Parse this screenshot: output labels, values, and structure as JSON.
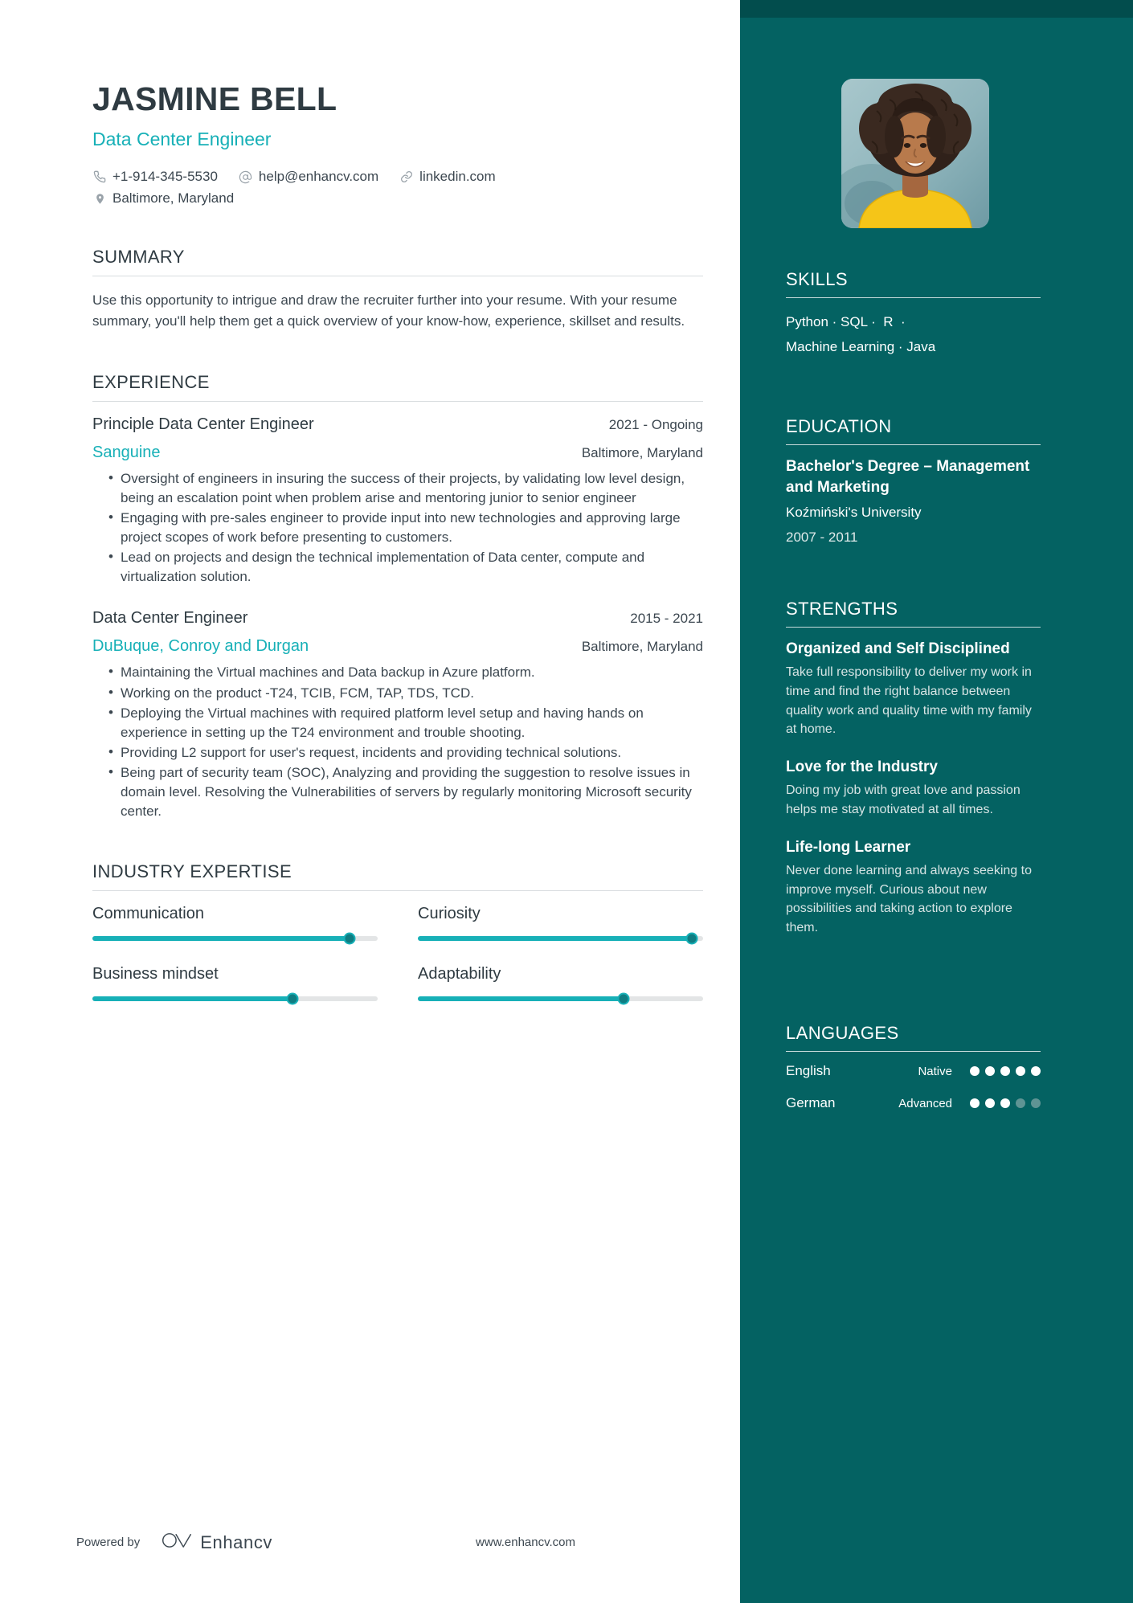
{
  "theme": {
    "sidebar_bg": "#046262",
    "sidebar_top_strip": "#024d4d",
    "accent": "#17b0b7",
    "text_dark": "#2f3b42",
    "text_body": "#3c4750"
  },
  "header": {
    "name": "JASMINE BELL",
    "role": "Data Center Engineer",
    "contacts": [
      {
        "icon": "phone-icon",
        "value": "+1-914-345-5530"
      },
      {
        "icon": "email-icon",
        "value": "help@enhancv.com"
      },
      {
        "icon": "link-icon",
        "value": "linkedin.com"
      }
    ],
    "location": {
      "icon": "location-pin-icon",
      "value": "Baltimore, Maryland"
    }
  },
  "summary": {
    "heading": "SUMMARY",
    "text": "Use this opportunity to intrigue and draw the recruiter further into your resume. With your resume summary, you'll help them get a quick overview of your know-how, experience, skillset and results."
  },
  "experience": {
    "heading": "EXPERIENCE",
    "jobs": [
      {
        "title": "Principle Data Center Engineer",
        "dates": "2021 - Ongoing",
        "company": "Sanguine",
        "location": "Baltimore, Maryland",
        "bullets": [
          "Oversight of engineers in insuring the success of their projects, by validating low level design, being an escalation point when problem arise and mentoring junior to senior engineer",
          "Engaging with pre-sales engineer to provide input into new technologies and approving large project scopes of work before presenting to customers.",
          "Lead on projects and design the technical implementation of Data center, compute and virtualization solution."
        ]
      },
      {
        "title": "Data Center Engineer",
        "dates": "2015 - 2021",
        "company": "DuBuque, Conroy and Durgan",
        "location": "Baltimore, Maryland",
        "bullets": [
          "Maintaining the Virtual machines and Data backup in Azure platform.",
          "Working on the product -T24, TCIB, FCM, TAP, TDS, TCD.",
          "Deploying the Virtual machines with required platform level setup and having hands on experience in setting up the T24 environment and trouble shooting.",
          "Providing L2 support for user's request, incidents and providing technical solutions.",
          "Being part of security team (SOC), Analyzing and providing the suggestion to resolve issues in\ndomain level. Resolving the Vulnerabilities of servers by regularly monitoring Microsoft security center."
        ]
      }
    ]
  },
  "industry_expertise": {
    "heading": "INDUSTRY EXPERTISE",
    "items": [
      {
        "label": "Communication",
        "value": 90
      },
      {
        "label": "Curiosity",
        "value": 96
      },
      {
        "label": "Business mindset",
        "value": 70
      },
      {
        "label": "Adaptability",
        "value": 72
      }
    ]
  },
  "skills": {
    "heading": "SKILLS",
    "lines": [
      "Python · SQL ·  R  ·",
      "Machine Learning · Java"
    ]
  },
  "education": {
    "heading": "EDUCATION",
    "degree": "Bachelor's Degree – Management and Marketing",
    "school": "Koźmiński's University",
    "dates": "2007 - 2011"
  },
  "strengths": {
    "heading": "STRENGTHS",
    "items": [
      {
        "title": "Organized and Self Disciplined",
        "text": "Take full responsibility to deliver my work in time and find the right balance between quality work and quality time with my family at home."
      },
      {
        "title": "Love for the Industry",
        "text": "Doing my job with great love and passion helps me stay motivated at all times."
      },
      {
        "title": "Life-long Learner",
        "text": "Never done learning and always seeking to improve myself. Curious about new possibilities and taking action to explore them."
      }
    ]
  },
  "languages": {
    "heading": "LANGUAGES",
    "items": [
      {
        "name": "English",
        "level": "Native",
        "filled": 5,
        "total": 5
      },
      {
        "name": "German",
        "level": "Advanced",
        "filled": 3,
        "total": 5
      }
    ]
  },
  "footer": {
    "powered_by": "Powered by",
    "brand": "Enhancv",
    "url": "www.enhancv.com"
  }
}
